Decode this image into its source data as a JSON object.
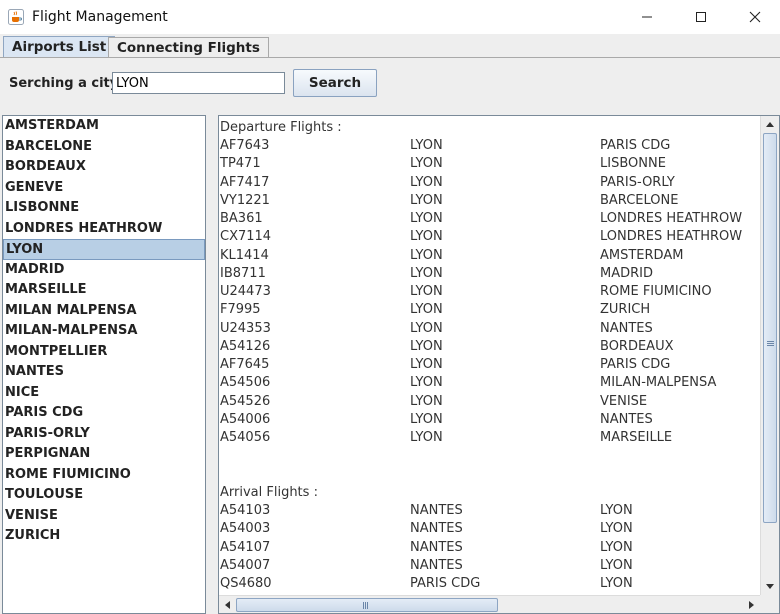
{
  "window": {
    "title": "Flight Management",
    "app_icon": "java-cup-icon"
  },
  "tabs": [
    {
      "label": "Airports List",
      "active": true
    },
    {
      "label": "Connecting Flights",
      "active": false
    }
  ],
  "search": {
    "label": "Serching a city:",
    "value": "LYON",
    "button_label": "Search"
  },
  "cities": [
    "AMSTERDAM",
    "BARCELONE",
    "BORDEAUX",
    "GENEVE",
    "LISBONNE",
    "LONDRES HEATHROW",
    "LYON",
    "MADRID",
    "MARSEILLE",
    "MILAN MALPENSA",
    "MILAN-MALPENSA",
    "MONTPELLIER",
    "NANTES",
    "NICE",
    "PARIS CDG",
    "PARIS-ORLY",
    "PERPIGNAN",
    "ROME FIUMICINO",
    "TOULOUSE",
    "VENISE",
    "ZURICH"
  ],
  "selected_city": "LYON",
  "departures": {
    "title": "Departure Flights :",
    "rows": [
      [
        "AF7643",
        "LYON",
        "PARIS CDG"
      ],
      [
        "TP471",
        "LYON",
        "LISBONNE"
      ],
      [
        "AF7417",
        "LYON",
        "PARIS-ORLY"
      ],
      [
        "VY1221",
        "LYON",
        "BARCELONE"
      ],
      [
        "BA361",
        "LYON",
        "LONDRES HEATHROW"
      ],
      [
        "CX7114",
        "LYON",
        "LONDRES HEATHROW"
      ],
      [
        "KL1414",
        "LYON",
        "AMSTERDAM"
      ],
      [
        "IB8711",
        "LYON",
        "MADRID"
      ],
      [
        "U24473",
        "LYON",
        "ROME FIUMICINO"
      ],
      [
        "F7995",
        "LYON",
        "ZURICH"
      ],
      [
        "U24353",
        "LYON",
        "NANTES"
      ],
      [
        "A54126",
        "LYON",
        "BORDEAUX"
      ],
      [
        "AF7645",
        "LYON",
        "PARIS CDG"
      ],
      [
        "A54506",
        "LYON",
        "MILAN-MALPENSA"
      ],
      [
        "A54526",
        "LYON",
        "VENISE"
      ],
      [
        "A54006",
        "LYON",
        "NANTES"
      ],
      [
        "A54056",
        "LYON",
        "MARSEILLE"
      ]
    ]
  },
  "arrivals": {
    "title": "Arrival Flights :",
    "rows": [
      [
        "A54103",
        "NANTES",
        "LYON"
      ],
      [
        "A54003",
        "NANTES",
        "LYON"
      ],
      [
        "A54107",
        "NANTES",
        "LYON"
      ],
      [
        "A54007",
        "NANTES",
        "LYON"
      ],
      [
        "QS4680",
        "PARIS CDG",
        "LYON"
      ]
    ]
  }
}
